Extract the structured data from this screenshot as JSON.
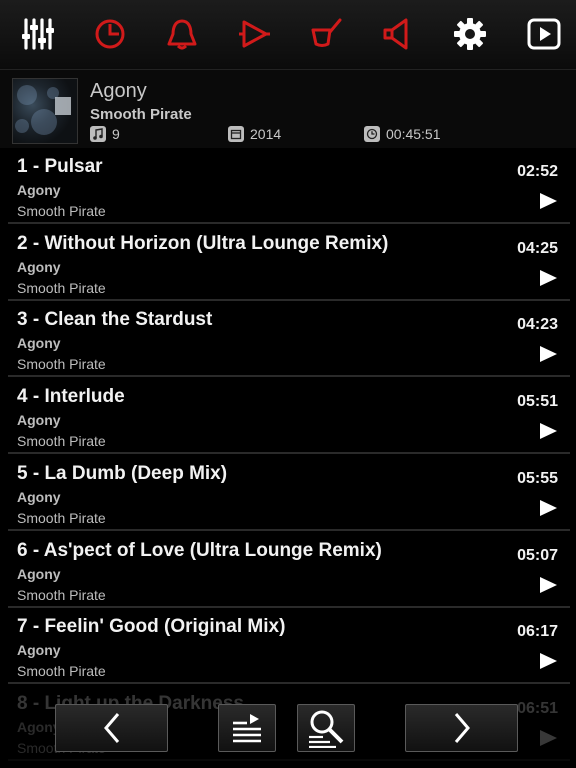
{
  "toolbar": {
    "icons": [
      "equalizer-icon",
      "sleep-timer-icon",
      "alarm-bell-icon",
      "playback-mode-icon",
      "skin-brush-icon",
      "volume-icon",
      "settings-gear-icon",
      "now-playing-icon"
    ],
    "accent_color": "#d11a1a",
    "neutral_color": "#ffffff"
  },
  "album": {
    "title": "Agony",
    "artist": "Smooth Pirate",
    "track_count": "9",
    "year": "2014",
    "total_duration": "00:45:51"
  },
  "tracks": [
    {
      "title": "1 - Pulsar",
      "album": "Agony",
      "artist": "Smooth Pirate",
      "duration": "02:52"
    },
    {
      "title": "2 - Without Horizon (Ultra Lounge Remix)",
      "album": "Agony",
      "artist": "Smooth Pirate",
      "duration": "04:25"
    },
    {
      "title": "3 - Clean the Stardust",
      "album": "Agony",
      "artist": "Smooth Pirate",
      "duration": "04:23"
    },
    {
      "title": "4 - Interlude",
      "album": "Agony",
      "artist": "Smooth Pirate",
      "duration": "05:51"
    },
    {
      "title": "5 - La Dumb (Deep Mix)",
      "album": "Agony",
      "artist": "Smooth Pirate",
      "duration": "05:55"
    },
    {
      "title": "6 - As'pect of Love  (Ultra Lounge Remix)",
      "album": "Agony",
      "artist": "Smooth Pirate",
      "duration": "05:07"
    },
    {
      "title": "7 - Feelin' Good  (Original Mix)",
      "album": "Agony",
      "artist": "Smooth Pirate",
      "duration": "06:17"
    },
    {
      "title": "8 - Light up the Darkness",
      "album": "Agony",
      "artist": "Smooth Pirate",
      "duration": "06:51"
    }
  ],
  "bottom_nav": {
    "icons": [
      "previous-chevron-icon",
      "playlist-queue-icon",
      "search-list-icon",
      "next-chevron-icon"
    ]
  }
}
